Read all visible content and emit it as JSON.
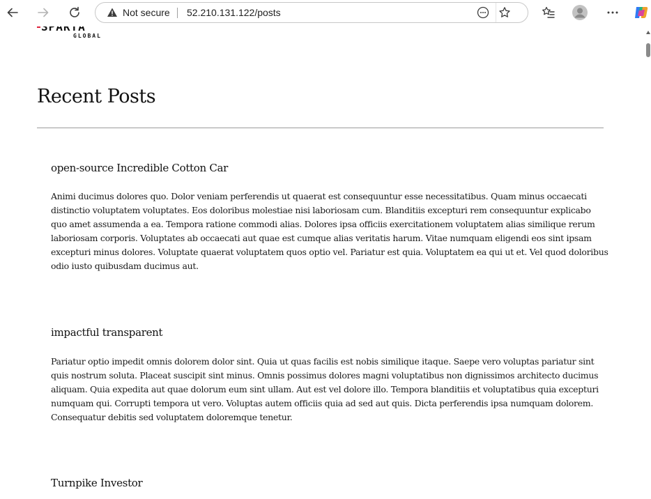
{
  "browser": {
    "security_label": "Not secure",
    "url": "52.210.131.122/posts",
    "icons": [
      "back-icon",
      "forward-icon",
      "reload-icon",
      "warning-icon",
      "reading-mode-icon",
      "favorite-star-icon",
      "favorites-icon",
      "profile-icon",
      "more-icon",
      "copilot-icon"
    ]
  },
  "site": {
    "logo_main": "SPARTA",
    "logo_sub": "GLOBAL",
    "accent_color": "#e0233c"
  },
  "page": {
    "title": "Recent Posts"
  },
  "posts": [
    {
      "title": "open-source Incredible Cotton Car",
      "body": "Animi ducimus dolores quo. Dolor veniam perferendis ut quaerat est consequuntur esse necessitatibus. Quam minus occaecati distinctio voluptatem voluptates. Eos doloribus molestiae nisi laboriosam cum. Blanditiis excepturi rem consequuntur explicabo quo amet assumenda a ea. Tempora ratione commodi alias. Dolores ipsa officiis exercitationem voluptatem alias similique rerum laboriosam corporis. Voluptates ab occaecati aut quae est cumque alias veritatis harum. Vitae numquam eligendi eos sint ipsam excepturi minus dolores. Voluptate quaerat voluptatem quos optio vel. Pariatur est quia. Voluptatem ea qui ut et. Vel quod doloribus odio iusto quibusdam ducimus aut."
    },
    {
      "title": "impactful transparent",
      "body": "Pariatur optio impedit omnis dolorem dolor sint. Quia ut quas facilis est nobis similique itaque. Saepe vero voluptas pariatur sint quis nostrum soluta. Placeat suscipit sint minus. Omnis possimus dolores magni voluptatibus non dignissimos architecto ducimus aliquam. Quia expedita aut quae dolorum eum sint ullam. Aut est vel dolore illo. Tempora blanditiis et voluptatibus quia excepturi numquam qui. Corrupti tempora ut vero. Voluptas autem officiis quia ad sed aut quis. Dicta perferendis ipsa numquam dolorem. Consequatur debitis sed voluptatem doloremque tenetur."
    },
    {
      "title": "Turnpike Investor",
      "body": ""
    }
  ]
}
